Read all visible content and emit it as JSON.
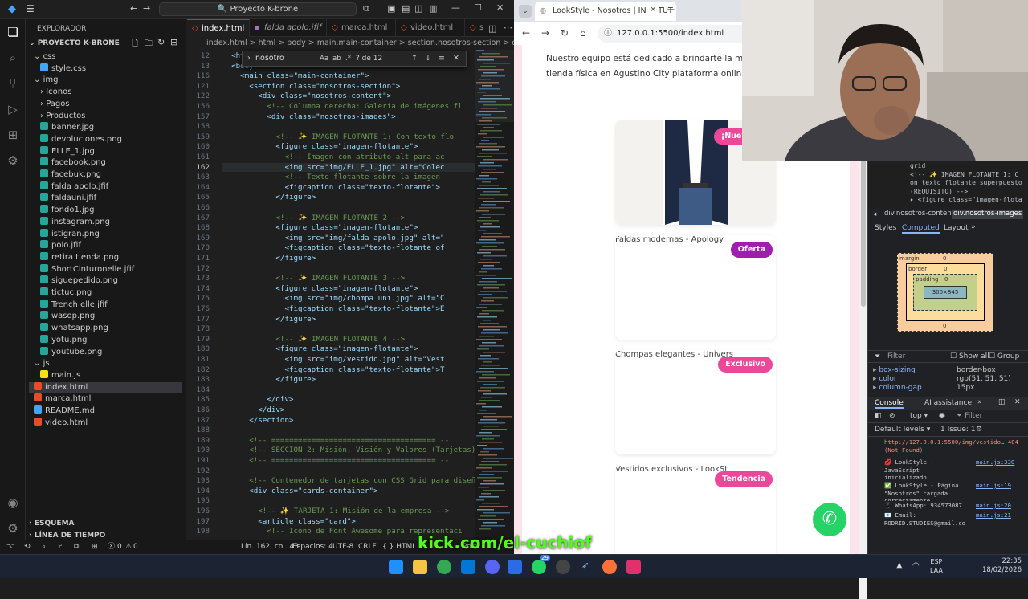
{
  "vscode": {
    "search": "Proyecto K-brone",
    "explorer_title": "EXPLORADOR",
    "project": "PROYECTO K-BRONE",
    "tree": [
      {
        "label": "css",
        "depth": 1,
        "type": "folder-open"
      },
      {
        "label": "style.css",
        "depth": 2,
        "type": "css"
      },
      {
        "label": "img",
        "depth": 1,
        "type": "folder-open"
      },
      {
        "label": "Iconos",
        "depth": 2,
        "type": "folder"
      },
      {
        "label": "Pagos",
        "depth": 2,
        "type": "folder"
      },
      {
        "label": "Productos",
        "depth": 2,
        "type": "folder"
      },
      {
        "label": "banner.jpg",
        "depth": 2,
        "type": "img"
      },
      {
        "label": "devoluciones.png",
        "depth": 2,
        "type": "img"
      },
      {
        "label": "ELLE_1.jpg",
        "depth": 2,
        "type": "img"
      },
      {
        "label": "facebook.png",
        "depth": 2,
        "type": "img"
      },
      {
        "label": "facebuk.png",
        "depth": 2,
        "type": "img"
      },
      {
        "label": "falda apolo.jfif",
        "depth": 2,
        "type": "img"
      },
      {
        "label": "faldauni.jfif",
        "depth": 2,
        "type": "img"
      },
      {
        "label": "fondo1.jpg",
        "depth": 2,
        "type": "img"
      },
      {
        "label": "instagram.png",
        "depth": 2,
        "type": "img"
      },
      {
        "label": "istigran.png",
        "depth": 2,
        "type": "img"
      },
      {
        "label": "polo.jfif",
        "depth": 2,
        "type": "img"
      },
      {
        "label": "retira tienda.png",
        "depth": 2,
        "type": "img"
      },
      {
        "label": "ShortCinturonelle.jfif",
        "depth": 2,
        "type": "img"
      },
      {
        "label": "siguepedido.png",
        "depth": 2,
        "type": "img"
      },
      {
        "label": "tictuc.png",
        "depth": 2,
        "type": "img"
      },
      {
        "label": "Trench elle.jfif",
        "depth": 2,
        "type": "img"
      },
      {
        "label": "wasop.png",
        "depth": 2,
        "type": "img"
      },
      {
        "label": "whatsapp.png",
        "depth": 2,
        "type": "img"
      },
      {
        "label": "yotu.png",
        "depth": 2,
        "type": "img"
      },
      {
        "label": "youtube.png",
        "depth": 2,
        "type": "img"
      },
      {
        "label": "js",
        "depth": 1,
        "type": "folder-open"
      },
      {
        "label": "main.js",
        "depth": 2,
        "type": "js"
      },
      {
        "label": "index.html",
        "depth": 1,
        "type": "html"
      },
      {
        "label": "marca.html",
        "depth": 1,
        "type": "html"
      },
      {
        "label": "README.md",
        "depth": 1,
        "type": "md"
      },
      {
        "label": "video.html",
        "depth": 1,
        "type": "html"
      }
    ],
    "outline": "ESQUEMA",
    "timeline": "LÍNEA DE TIEMPO",
    "tabs": [
      "index.html",
      "falda apolo.jfif",
      "marca.html",
      "video.html",
      "s"
    ],
    "breadcrumbs": "index.html > html > body > main.main-container > section.nosotros-section > div",
    "find": {
      "value": "nosotro",
      "count": "? de 12"
    },
    "code": [
      {
        "n": "12",
        "t": "  <html"
      },
      {
        "n": "13",
        "t": "  <body"
      },
      {
        "n": "116",
        "t": "    <main class=\"main-container\">"
      },
      {
        "n": "121",
        "t": "      <section class=\"nosotros-section\">"
      },
      {
        "n": "122",
        "t": "        <div class=\"nosotros-content\">"
      },
      {
        "n": "156",
        "t": "          <!-- Columna derecha: Galería de imágenes fl"
      },
      {
        "n": "157",
        "t": "          <div class=\"nosotros-images\">"
      },
      {
        "n": "158",
        "t": ""
      },
      {
        "n": "159",
        "t": "            <!-- ✨ IMAGEN FLOTANTE 1: Con texto flo"
      },
      {
        "n": "160",
        "t": "            <figure class=\"imagen-flotante\">"
      },
      {
        "n": "161",
        "t": "              <!-- Imagen con atributo alt para ac"
      },
      {
        "n": "162",
        "t": "              <img src=\"img/ELLE_1.jpg\" alt=\"Colec"
      },
      {
        "n": "163",
        "t": "              <!-- Texto flotante sobre la imagen"
      },
      {
        "n": "164",
        "t": "              <figcaption class=\"texto-flotante\">"
      },
      {
        "n": "165",
        "t": "            </figure>"
      },
      {
        "n": "166",
        "t": ""
      },
      {
        "n": "167",
        "t": "            <!-- ✨ IMAGEN FLOTANTE 2 -->"
      },
      {
        "n": "168",
        "t": "            <figure class=\"imagen-flotante\">"
      },
      {
        "n": "169",
        "t": "              <img src=\"img/falda apolo.jpg\" alt=\""
      },
      {
        "n": "170",
        "t": "              <figcaption class=\"texto-flotante of"
      },
      {
        "n": "171",
        "t": "            </figure>"
      },
      {
        "n": "172",
        "t": ""
      },
      {
        "n": "173",
        "t": "            <!-- ✨ IMAGEN FLOTANTE 3 -->"
      },
      {
        "n": "174",
        "t": "            <figure class=\"imagen-flotante\">"
      },
      {
        "n": "175",
        "t": "              <img src=\"img/chompa uni.jpg\" alt=\"C"
      },
      {
        "n": "176",
        "t": "              <figcaption class=\"texto-flotante\">E"
      },
      {
        "n": "177",
        "t": "            </figure>"
      },
      {
        "n": "178",
        "t": ""
      },
      {
        "n": "179",
        "t": "            <!-- ✨ IMAGEN FLOTANTE 4 -->"
      },
      {
        "n": "180",
        "t": "            <figure class=\"imagen-flotante\">"
      },
      {
        "n": "181",
        "t": "              <img src=\"img/vestido.jpg\" alt=\"Vest"
      },
      {
        "n": "182",
        "t": "              <figcaption class=\"texto-flotante\">T"
      },
      {
        "n": "183",
        "t": "            </figure>"
      },
      {
        "n": "184",
        "t": ""
      },
      {
        "n": "185",
        "t": "          </div>"
      },
      {
        "n": "186",
        "t": "        </div>"
      },
      {
        "n": "187",
        "t": "      </section>"
      },
      {
        "n": "188",
        "t": ""
      },
      {
        "n": "189",
        "t": "      <!-- ===================================== --"
      },
      {
        "n": "190",
        "t": "      <!-- SECCIÓN 2: Misión, Visión y Valores (Tarjetas)"
      },
      {
        "n": "191",
        "t": "      <!-- ===================================== --"
      },
      {
        "n": "192",
        "t": ""
      },
      {
        "n": "193",
        "t": "      <!-- Contenedor de tarjetas con CSS Grid para diseño"
      },
      {
        "n": "194",
        "t": "      <div class=\"cards-container\">"
      },
      {
        "n": "195",
        "t": ""
      },
      {
        "n": "196",
        "t": "        <!-- ✨ TARJETA 1: Misión de la empresa -->"
      },
      {
        "n": "197",
        "t": "        <article class=\"card\">"
      },
      {
        "n": "198",
        "t": "          <!-- Icono de Font Awesome para representaci"
      }
    ],
    "status": {
      "errors": "0",
      "warnings": "0",
      "position": "Lín. 162, col. 43",
      "spaces": "Espacios: 4",
      "encoding": "UTF-8",
      "eol": "CRLF",
      "lang": "HTML",
      "port": "Port"
    }
  },
  "browser": {
    "tab_title": "LookStyle - Nosotros | INSTITUT",
    "url": "127.0.0.1:5500/index.html",
    "paragraph": "Nuestro equipo está dedicado a brindarte la mejor e ya sea en nuestra tienda física en Agustino City plataforma online disponible 24/7.",
    "cards": [
      {
        "alt": "",
        "badge": "¡Nueva Colecci",
        "color": "#ec4899"
      },
      {
        "alt": "Faldas modernas - Apology",
        "badge": "Oferta",
        "color": "#a21caf"
      },
      {
        "alt": "Chompas elegantes - Univers",
        "badge": "Exclusivo",
        "color": "#ec4899"
      },
      {
        "alt": "Vestidos exclusivos - LookSt",
        "badge": "Tendencia",
        "color": "#ec4899"
      }
    ]
  },
  "devtools": {
    "code_lines": [
      "grid",
      "<!-- ✨ IMAGEN FLOTANTE 1: C",
      "on texto flotante superpuesto",
      "(REQUISITO) -->",
      "▸ <figure class=\"imagen-flota"
    ],
    "crumbs": [
      "div.nosotros-content",
      "div.nosotros-images"
    ],
    "tabs": [
      "Styles",
      "Computed",
      "Layout"
    ],
    "box": {
      "margin": "margin",
      "border": "border",
      "padding": "padding",
      "size": "300×845",
      "zero": "0"
    },
    "filter": "Filter",
    "show_all": "Show all",
    "group": "Group",
    "props": [
      {
        "k": "box-sizing",
        "v": "border-box"
      },
      {
        "k": "color",
        "v": "rgb(51, 51, 51)"
      },
      {
        "k": "column-gap",
        "v": "15px"
      }
    ],
    "console_tabs": [
      "Console",
      "AI assistance"
    ],
    "top": "top",
    "default_levels": "Default levels",
    "issue": "1 Issue: 1",
    "logs": [
      {
        "t": "http://127.0.0.1:5500/img/vestido… 404 (Not Found)",
        "src": ""
      },
      {
        "t": "💋 LookStyle - JavaScript inicializado correctamente",
        "src": "main.js:330"
      },
      {
        "t": "✅ LookStyle - Página \"Nosotros\" cargada correctamente",
        "src": "main.js:19"
      },
      {
        "t": "📱 WhatsApp: 934573087",
        "src": "main.js:20"
      },
      {
        "t": "📧 Email: RODRID.STUDIES@gmail.com",
        "src": "main.js:21"
      }
    ]
  },
  "overlay": {
    "kick": "kick.com/el-cuchiof"
  },
  "taskbar": {
    "lang1": "ESP",
    "lang2": "LAA",
    "time": "22:35",
    "date": "18/02/2026",
    "badge": "29"
  }
}
